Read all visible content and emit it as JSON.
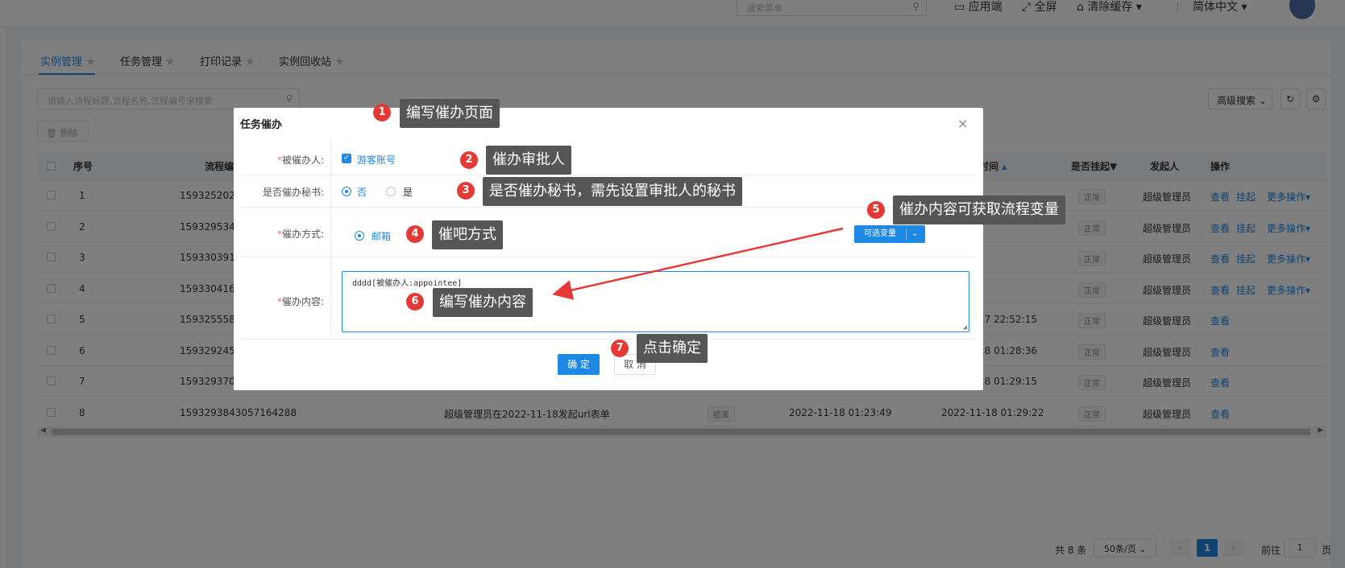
{
  "topbar": {
    "search_placeholder": "搜索菜单",
    "app_label": "应用端",
    "fullscreen_label": "全屏",
    "clear_cache_label": "清除缓存",
    "language_label": "简体中文"
  },
  "tabs": [
    {
      "label": "实例管理",
      "active": true
    },
    {
      "label": "任务管理",
      "active": false
    },
    {
      "label": "打印记录",
      "active": false
    },
    {
      "label": "实例回收站",
      "active": false
    }
  ],
  "toolbar": {
    "search_placeholder": "请输入流程标题,流程名称,流程编号来搜索",
    "delete_label": "删除",
    "advanced_search_label": "高级搜索"
  },
  "table": {
    "headers": {
      "index": "序号",
      "flow_no": "流程编",
      "end_time": "时间",
      "suspended": "是否挂起",
      "initiator": "发起人",
      "actions": "操作"
    },
    "rows": [
      {
        "index": "1",
        "flow_no": "15932520200",
        "end_time": "",
        "suspended": "正常",
        "initiator": "超级管理员",
        "actions": [
          "查看",
          "挂起",
          "更多操作"
        ]
      },
      {
        "index": "2",
        "flow_no": "15932953424",
        "end_time": "",
        "suspended": "正常",
        "initiator": "超级管理员",
        "actions": [
          "查看",
          "挂起",
          "更多操作"
        ]
      },
      {
        "index": "3",
        "flow_no": "15933039168",
        "end_time": "",
        "suspended": "正常",
        "initiator": "超级管理员",
        "actions": [
          "查看",
          "挂起",
          "更多操作"
        ]
      },
      {
        "index": "4",
        "flow_no": "15933041634",
        "end_time": "",
        "suspended": "正常",
        "initiator": "超级管理员",
        "actions": [
          "查看",
          "挂起",
          "更多操作"
        ]
      },
      {
        "index": "5",
        "flow_no": "15932555870",
        "end_time": "17 22:52:15",
        "suspended": "正常",
        "initiator": "超级管理员",
        "actions": [
          "查看"
        ]
      },
      {
        "index": "6",
        "flow_no": "15932924570",
        "end_time": "18 01:28:36",
        "suspended": "正常",
        "initiator": "超级管理员",
        "actions": [
          "查看"
        ]
      },
      {
        "index": "7",
        "flow_no": "15932937050",
        "end_time": "18 01:29:15",
        "suspended": "正常",
        "initiator": "超级管理员",
        "actions": [
          "查看"
        ]
      },
      {
        "index": "8",
        "flow_no": "1593293843057164288",
        "title": "超级管理员在2022-11-18发起url表单",
        "status": "结束",
        "start_time": "2022-11-18 01:23:49",
        "end_time": "2022-11-18 01:29:22",
        "suspended": "正常",
        "initiator": "超级管理员",
        "actions": [
          "查看"
        ]
      }
    ]
  },
  "pagination": {
    "total": "共 8 条",
    "page_size": "50条/页",
    "current_page": "1",
    "goto_label": "前往",
    "goto_value": "1",
    "page_suffix": "页"
  },
  "dialog": {
    "title": "任务催办",
    "fields": {
      "reminded_label": "被催办人:",
      "reminded_value": "游客账号",
      "secretary_label": "是否催办秘书:",
      "secretary_no": "否",
      "secretary_yes": "是",
      "method_label": "催办方式:",
      "method_email": "邮箱",
      "variables_button": "可选变量",
      "content_label": "催办内容:",
      "content_value": "dddd[被催办人:appointee]"
    },
    "confirm_label": "确 定",
    "cancel_label": "取 消"
  },
  "annotations": [
    {
      "num": "1",
      "text": "编写催办页面"
    },
    {
      "num": "2",
      "text": "催办审批人"
    },
    {
      "num": "3",
      "text": "是否催办秘书，需先设置审批人的秘书"
    },
    {
      "num": "4",
      "text": "催吧方式"
    },
    {
      "num": "5",
      "text": "催办内容可获取流程变量"
    },
    {
      "num": "6",
      "text": "编写催办内容"
    },
    {
      "num": "7",
      "text": "点击确定"
    }
  ],
  "colors": {
    "primary": "#1e88e5",
    "annotation_red": "#e53935",
    "tooltip_bg": "#565656"
  }
}
